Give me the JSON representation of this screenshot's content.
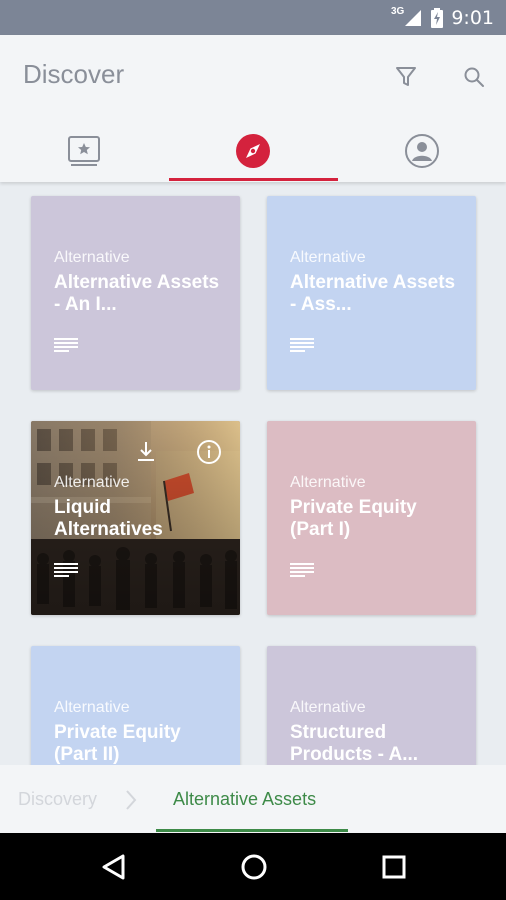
{
  "status_bar": {
    "network": "3G",
    "time": "9:01"
  },
  "app_bar": {
    "title": "Discover"
  },
  "tabs": [
    {
      "icon": "bookmark-star-icon",
      "selected": false
    },
    {
      "icon": "compass-icon",
      "selected": true
    },
    {
      "icon": "profile-icon",
      "selected": false
    }
  ],
  "cards": [
    {
      "category": "Alternative",
      "title": "Alternative Assets - An I...",
      "color": "#ccc6da"
    },
    {
      "category": "Alternative",
      "title": "Alternative Assets - Ass...",
      "color": "#c3d4f1"
    },
    {
      "category": "Alternative",
      "title": "Liquid Alternatives",
      "image": "city-street-photo"
    },
    {
      "category": "Alternative",
      "title": "Private Equity (Part I)",
      "color": "#dcbcc3"
    },
    {
      "category": "Alternative",
      "title": "Private Equity (Part II)",
      "color": "#c3d4f1"
    },
    {
      "category": "Alternative",
      "title": "Structured Products - A...",
      "color": "#ccc6da"
    }
  ],
  "breadcrumb": {
    "items": [
      "Discovery",
      "Alternative Assets"
    ]
  },
  "colors": {
    "accent": "#d4223d",
    "breadcrumb_active": "#3d8a48"
  }
}
